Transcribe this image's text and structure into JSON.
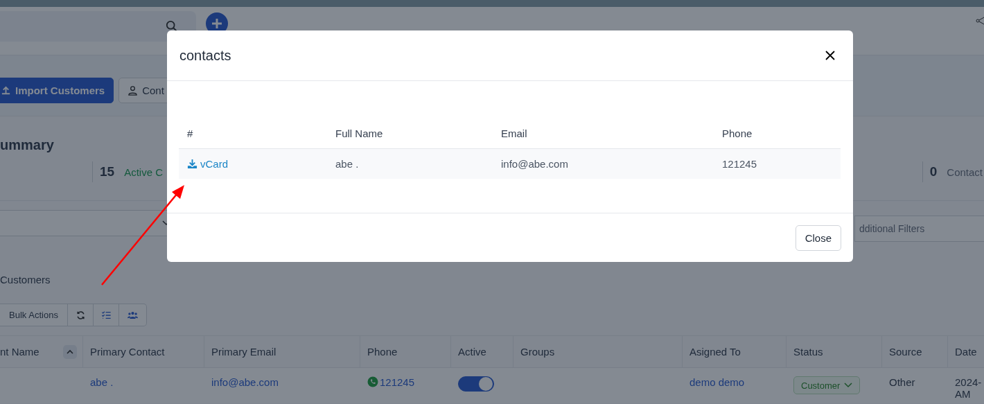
{
  "toolbar": {
    "buttons": [
      {
        "label": "Import Customers",
        "kind": "primary"
      },
      {
        "label": "Cont",
        "kind": "secondary"
      }
    ]
  },
  "summary": {
    "title": "ummary",
    "stats": [
      {
        "value": "15",
        "label": "Active C",
        "kind": "accent"
      },
      {
        "value": "0",
        "label": "Contact",
        "kind": "muted"
      }
    ]
  },
  "filters": {
    "additional_filters": "dditional Filters"
  },
  "customers": {
    "title": "Customers",
    "bulk_actions": "Bulk Actions"
  },
  "table": {
    "columns": [
      {
        "label": "nt Name",
        "sortable": true
      },
      {
        "label": "Primary Contact",
        "sortable": false
      },
      {
        "label": "Primary Email",
        "sortable": false
      },
      {
        "label": "Phone",
        "sortable": false
      },
      {
        "label": "Active",
        "sortable": false
      },
      {
        "label": "Groups",
        "sortable": false
      },
      {
        "label": "Asigned To",
        "sortable": false
      },
      {
        "label": "Status",
        "sortable": false
      },
      {
        "label": "Source",
        "sortable": false
      },
      {
        "label": "Date",
        "sortable": false
      }
    ],
    "rows": [
      {
        "cells": [
          {
            "kind": "empty"
          },
          {
            "kind": "link",
            "text": "abe ."
          },
          {
            "kind": "link",
            "text": "info@abe.com"
          },
          {
            "kind": "phone",
            "text": "121245"
          },
          {
            "kind": "toggle",
            "on": true
          },
          {
            "kind": "empty"
          },
          {
            "kind": "link",
            "text": "demo demo"
          },
          {
            "kind": "status",
            "text": "Customer"
          },
          {
            "kind": "text",
            "text": "Other"
          },
          {
            "kind": "lines",
            "lines": [
              "2024-",
              "AM"
            ]
          }
        ]
      }
    ]
  },
  "modal": {
    "title": "contacts",
    "columns": [
      "#",
      "Full Name",
      "Email",
      "Phone"
    ],
    "rows": [
      {
        "vcard": "vCard",
        "full_name": "abe .",
        "email": "info@abe.com",
        "phone": "121245"
      }
    ],
    "close_button": "Close"
  }
}
